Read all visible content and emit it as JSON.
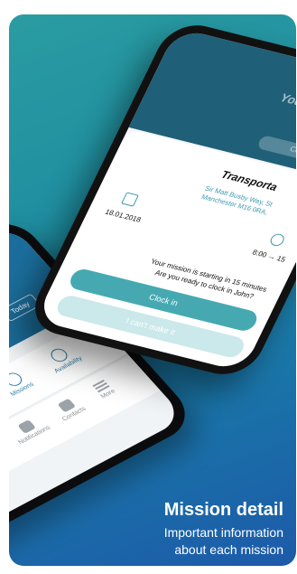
{
  "caption": {
    "title": "Mission detail",
    "subtitle_line1": "Important information",
    "subtitle_line2": "about each mission"
  },
  "main_phone": {
    "top_card": {
      "text": "Your n starting",
      "button": "Clock"
    },
    "sheet": {
      "title": "Transporta",
      "address_line1": "Sir Matt Busby Way, St",
      "address_line2": "Manchester M16 0RA,",
      "date": "18.01.2018",
      "time": "8:00 → 15",
      "message_line1": "Your mission is starting in 15 minutes",
      "message_line2": "Are you ready to clock in John?",
      "clock_in_label": "Clock in",
      "cant_make_label": "I can't make it"
    }
  },
  "back_phone": {
    "date_fragment": "d",
    "today_label": "Today",
    "nav_primary": [
      {
        "label": "Missions",
        "icon": "briefcase-icon"
      },
      {
        "label": "Availability",
        "icon": "smile-icon"
      }
    ],
    "nav_bottom": [
      {
        "label": "Notifications",
        "icon": "bell-icon"
      },
      {
        "label": "Contacts",
        "icon": "people-icon"
      },
      {
        "label": "More",
        "icon": "menu-icon"
      }
    ]
  },
  "colors": {
    "gradient_top": "#2a9ca1",
    "gradient_bottom": "#1c5aa9",
    "accent": "#46a9b2",
    "accent_light": "#cbe8ea",
    "address_color": "#3b9ab0"
  }
}
